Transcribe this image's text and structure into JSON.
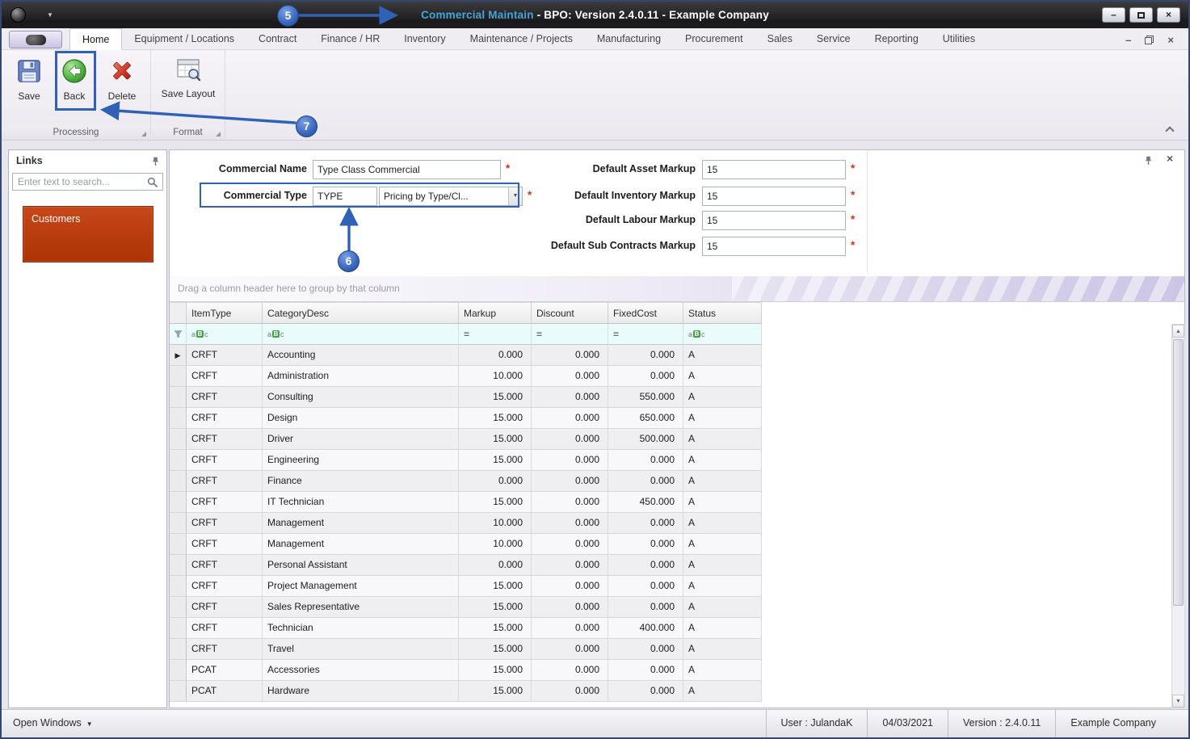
{
  "window": {
    "title_highlight": "Commercial Maintain",
    "title_rest": " - BPO: Version 2.4.0.11 - Example Company"
  },
  "ribbon": {
    "tabs": [
      {
        "label": "Home",
        "selected": true
      },
      {
        "label": "Equipment / Locations"
      },
      {
        "label": "Contract"
      },
      {
        "label": "Finance / HR"
      },
      {
        "label": "Inventory"
      },
      {
        "label": "Maintenance / Projects"
      },
      {
        "label": "Manufacturing"
      },
      {
        "label": "Procurement"
      },
      {
        "label": "Sales"
      },
      {
        "label": "Service"
      },
      {
        "label": "Reporting"
      },
      {
        "label": "Utilities"
      }
    ],
    "buttons": {
      "save": "Save",
      "back": "Back",
      "delete": "Delete",
      "save_layout": "Save Layout"
    },
    "groups": {
      "processing": "Processing",
      "format": "Format"
    }
  },
  "links_panel": {
    "title": "Links",
    "search_placeholder": "Enter text to search...",
    "items": [
      {
        "label": "Customers"
      }
    ]
  },
  "form": {
    "required_marker": "*",
    "commercial_name": {
      "label": "Commercial Name",
      "value": "Type Class Commercial"
    },
    "commercial_type": {
      "label": "Commercial Type",
      "value": "TYPE",
      "pricing": "Pricing by Type/Cl..."
    },
    "markups": [
      {
        "label": "Default Asset Markup",
        "value": "15"
      },
      {
        "label": "Default Inventory Markup",
        "value": "15"
      },
      {
        "label": "Default Labour Markup",
        "value": "15"
      },
      {
        "label": "Default Sub Contracts Markup",
        "value": "15"
      }
    ]
  },
  "grid": {
    "group_hint": "Drag a column header here to group by that column",
    "columns": [
      "ItemType",
      "CategoryDesc",
      "Markup",
      "Discount",
      "FixedCost",
      "Status"
    ],
    "filter": {
      "text_operator": "aBc",
      "numeric_operator": "="
    },
    "rows": [
      [
        "CRFT",
        "Accounting",
        "0.000",
        "0.000",
        "0.000",
        "A"
      ],
      [
        "CRFT",
        "Administration",
        "10.000",
        "0.000",
        "0.000",
        "A"
      ],
      [
        "CRFT",
        "Consulting",
        "15.000",
        "0.000",
        "550.000",
        "A"
      ],
      [
        "CRFT",
        "Design",
        "15.000",
        "0.000",
        "650.000",
        "A"
      ],
      [
        "CRFT",
        "Driver",
        "15.000",
        "0.000",
        "500.000",
        "A"
      ],
      [
        "CRFT",
        "Engineering",
        "15.000",
        "0.000",
        "0.000",
        "A"
      ],
      [
        "CRFT",
        "Finance",
        "0.000",
        "0.000",
        "0.000",
        "A"
      ],
      [
        "CRFT",
        "IT Technician",
        "15.000",
        "0.000",
        "450.000",
        "A"
      ],
      [
        "CRFT",
        "Management",
        "10.000",
        "0.000",
        "0.000",
        "A"
      ],
      [
        "CRFT",
        "Management",
        "10.000",
        "0.000",
        "0.000",
        "A"
      ],
      [
        "CRFT",
        "Personal Assistant",
        "0.000",
        "0.000",
        "0.000",
        "A"
      ],
      [
        "CRFT",
        "Project Management",
        "15.000",
        "0.000",
        "0.000",
        "A"
      ],
      [
        "CRFT",
        "Sales Representative",
        "15.000",
        "0.000",
        "0.000",
        "A"
      ],
      [
        "CRFT",
        "Technician",
        "15.000",
        "0.000",
        "400.000",
        "A"
      ],
      [
        "CRFT",
        "Travel",
        "15.000",
        "0.000",
        "0.000",
        "A"
      ],
      [
        "PCAT",
        "Accessories",
        "15.000",
        "0.000",
        "0.000",
        "A"
      ],
      [
        "PCAT",
        "Hardware",
        "15.000",
        "0.000",
        "0.000",
        "A"
      ]
    ]
  },
  "status_bar": {
    "open_windows": "Open Windows",
    "user": "User : JulandaK",
    "date": "04/03/2021",
    "version": "Version : 2.4.0.11",
    "company": "Example Company"
  },
  "annotations": {
    "callout_5": "5",
    "callout_6": "6",
    "callout_7": "7"
  },
  "colors": {
    "annotation_blue": "#2f62b7",
    "title_highlight": "#45a3d8",
    "customers_tile": "#bf3a12",
    "required_red": "#e02a1e"
  },
  "icons": {
    "app": "dark-sphere-logo",
    "dropdown_caret": "▼",
    "minimize": "–",
    "maximize": "square-shape",
    "restore": "overlapping-squares-shape",
    "close": "×",
    "pin": "pushpin-shape",
    "search": "magnifier-shape",
    "save": "blue-floppy-disk",
    "back": "green-circle-left-arrow",
    "delete": "red-x",
    "save_layout": "layout-grid-with-magnifier",
    "dialog_launcher": "corner-triangle",
    "collapse_ribbon": "chevron-up",
    "filter": "funnel-shape",
    "scroll_up": "▲",
    "scroll_down": "▼",
    "row_arrow": "▶"
  }
}
